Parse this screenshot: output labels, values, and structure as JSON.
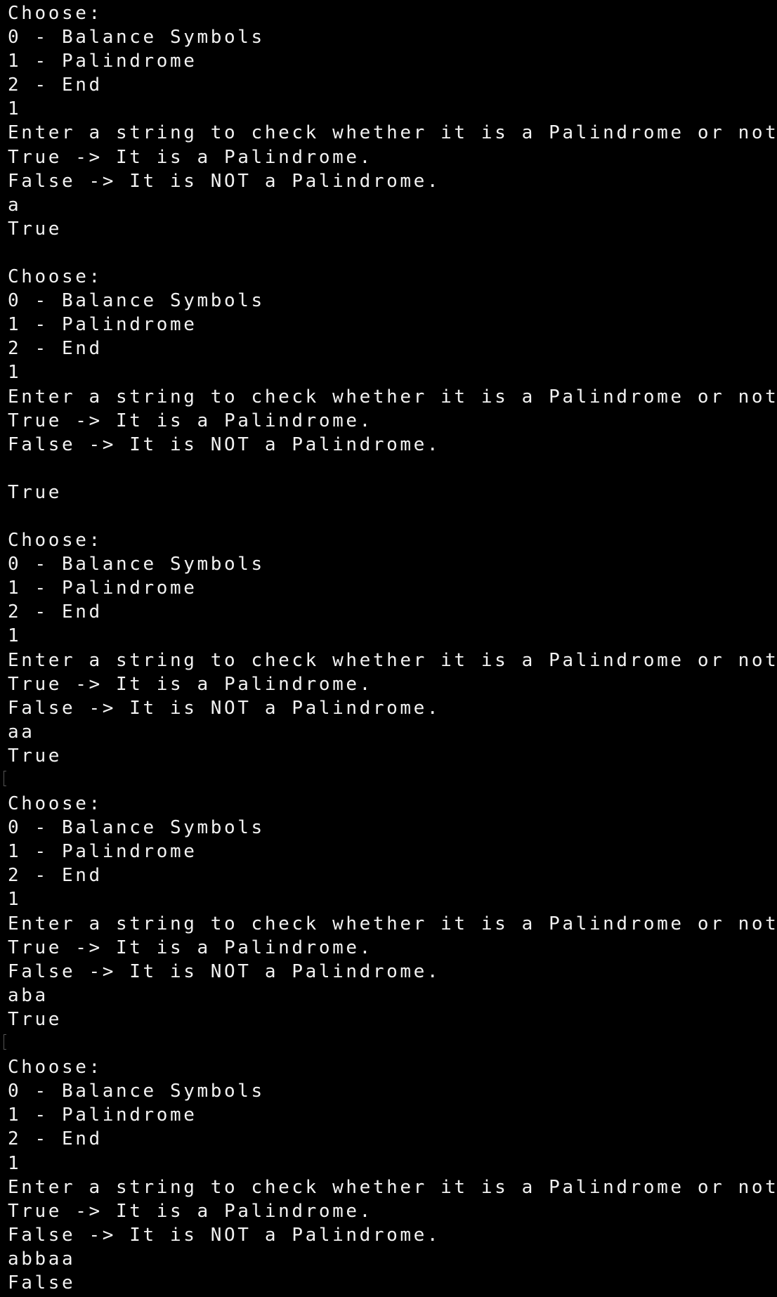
{
  "terminal": {
    "lines": [
      "Choose:",
      "0 - Balance Symbols",
      "1 - Palindrome",
      "2 - End",
      "1",
      "Enter a string to check whether it is a Palindrome or not.",
      "True -> It is a Palindrome.",
      "False -> It is NOT a Palindrome.",
      "a",
      "True",
      "",
      "Choose:",
      "0 - Balance Symbols",
      "1 - Palindrome",
      "2 - End",
      "1",
      "Enter a string to check whether it is a Palindrome or not.",
      "True -> It is a Palindrome.",
      "False -> It is NOT a Palindrome.",
      "",
      "True",
      "",
      "Choose:",
      "0 - Balance Symbols",
      "1 - Palindrome",
      "2 - End",
      "1",
      "Enter a string to check whether it is a Palindrome or not.",
      "True -> It is a Palindrome.",
      "False -> It is NOT a Palindrome.",
      "aa",
      "True",
      "",
      "Choose:",
      "0 - Balance Symbols",
      "1 - Palindrome",
      "2 - End",
      "1",
      "Enter a string to check whether it is a Palindrome or not.",
      "True -> It is a Palindrome.",
      "False -> It is NOT a Palindrome.",
      "aba",
      "True",
      "",
      "Choose:",
      "0 - Balance Symbols",
      "1 - Palindrome",
      "2 - End",
      "1",
      "Enter a string to check whether it is a Palindrome or not.",
      "True -> It is a Palindrome.",
      "False -> It is NOT a Palindrome.",
      "abbaa",
      "False"
    ],
    "cursor_mark_lines": [
      32,
      43
    ],
    "colors": {
      "background": "#000000",
      "foreground": "#f2f2f2"
    }
  }
}
